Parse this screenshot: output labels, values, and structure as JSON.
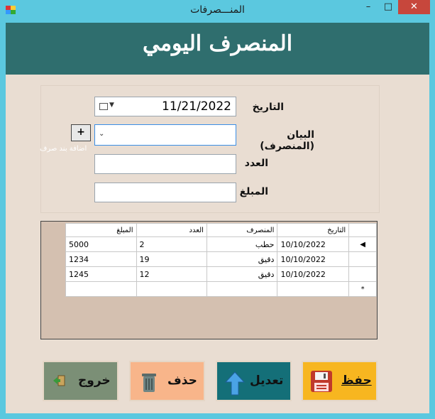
{
  "window": {
    "title": "المنـــصرفات",
    "minimize": "–",
    "maximize": "□",
    "close": "✕"
  },
  "header": {
    "title": "المنصرف اليومي"
  },
  "form": {
    "date_label": "التاريخ",
    "date_value": "11/21/2022",
    "item_label": "البيان (المنصرف)",
    "item_value": "",
    "add_button": "+",
    "add_hint": "اضافة بند صرف",
    "count_label": "العدد",
    "count_value": "",
    "amount_label": "المبلغ",
    "amount_value": ""
  },
  "grid": {
    "columns": [
      "التاريخ",
      "المنصرف",
      "العدد",
      "المبلغ"
    ],
    "rows": [
      {
        "date": "10/10/2022",
        "name": "حطب",
        "count": "2",
        "amount": "5000"
      },
      {
        "date": "10/10/2022",
        "name": "دقيق",
        "count": "19",
        "amount": "1234"
      },
      {
        "date": "10/10/2022",
        "name": "دقيق",
        "count": "12",
        "amount": "1245"
      }
    ],
    "current_row_marker": "◀",
    "new_row_marker": "*"
  },
  "buttons": {
    "save": "حفظ",
    "edit": "تعديل",
    "delete": "حذف",
    "exit": "خروج"
  },
  "colors": {
    "header": "#2f6e6e",
    "save": "#f7b620",
    "edit": "#146f78",
    "delete": "#f8b58a",
    "exit": "#7b8f76"
  }
}
